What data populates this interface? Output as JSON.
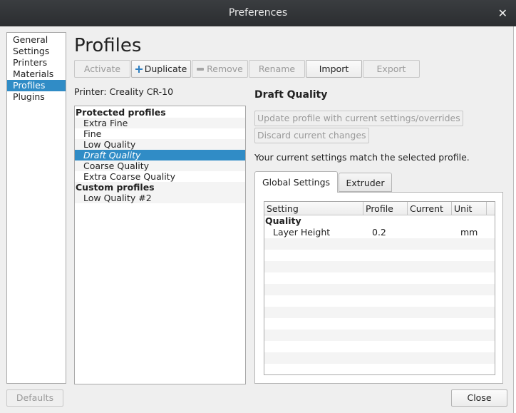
{
  "window": {
    "title": "Preferences",
    "close_glyph": "✕"
  },
  "sidebar": {
    "items": [
      {
        "label": "General",
        "selected": false
      },
      {
        "label": "Settings",
        "selected": false
      },
      {
        "label": "Printers",
        "selected": false
      },
      {
        "label": "Materials",
        "selected": false
      },
      {
        "label": "Profiles",
        "selected": true
      },
      {
        "label": "Plugins",
        "selected": false
      }
    ]
  },
  "page": {
    "heading": "Profiles"
  },
  "toolbar": {
    "activate": "Activate",
    "duplicate": "Duplicate",
    "remove": "Remove",
    "rename": "Rename",
    "import": "Import",
    "export": "Export"
  },
  "printer": {
    "label": "Printer: Creality CR-10"
  },
  "profiles": {
    "protected_header": "Protected profiles",
    "protected": [
      "Extra Fine",
      "Fine",
      "Low Quality",
      "Draft Quality",
      "Coarse Quality",
      "Extra Coarse Quality"
    ],
    "selected": "Draft Quality",
    "custom_header": "Custom profiles",
    "custom": [
      "Low Quality #2"
    ]
  },
  "detail": {
    "title": "Draft Quality",
    "update_button": "Update profile with current settings/overrides",
    "discard_button": "Discard current changes",
    "status": "Your current settings match the selected profile.",
    "tabs": [
      {
        "label": "Global Settings",
        "active": true
      },
      {
        "label": "Extruder",
        "active": false
      }
    ],
    "table": {
      "columns": [
        "Setting",
        "Profile",
        "Current",
        "Unit"
      ],
      "group": "Quality",
      "rows": [
        {
          "setting": "Layer Height",
          "profile": "0.2",
          "current": "",
          "unit": "mm"
        }
      ]
    }
  },
  "footer": {
    "defaults": "Defaults",
    "close": "Close"
  },
  "colors": {
    "selection": "#308cc6",
    "titlebar": "#2b2d30",
    "accent_icon": "#2f7fc1"
  }
}
